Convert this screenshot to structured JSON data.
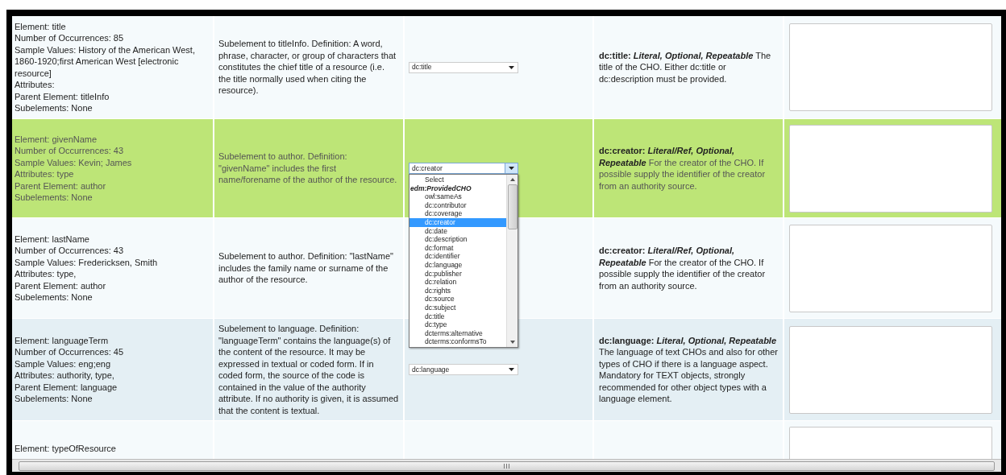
{
  "rows": [
    {
      "selected": false,
      "element_info": [
        "Element: title",
        "Number of Occurrences: 85",
        "Sample Values: History of the American West, 1860-1920;first American West [electronic resource]",
        "Attributes:",
        "Parent Element: titleInfo",
        "Subelements: None"
      ],
      "definition": "Subelement to titleInfo. Definition: A word, phrase, character, or group of characters that constitutes the chief title of a resource (i.e. the title normally used when citing the resource).",
      "mapping": {
        "value": "dc:title",
        "expanded": false
      },
      "note": {
        "term": "dc:title:",
        "qualifiers": "Literal, Optional, Repeatable",
        "text": "The title of the CHO. Either dc:title or dc:description must be provided."
      },
      "input": {
        "kind": "textarea"
      }
    },
    {
      "selected": true,
      "element_info": [
        "Element: givenName",
        "Number of Occurrences: 43",
        "Sample Values: Kevin; James",
        "Attributes: type",
        "Parent Element: author",
        "Subelements: None"
      ],
      "definition": "Subelement to author. Definition: \"givenName\" includes the first name/forename of the author of the resource.",
      "mapping": {
        "value": "dc:creator",
        "expanded": true,
        "options": [
          {
            "label": "Select",
            "kind": "option",
            "selected": false
          },
          {
            "label": "edm:ProvidedCHO",
            "kind": "group",
            "selected": false
          },
          {
            "label": "owl:sameAs",
            "kind": "option",
            "selected": false
          },
          {
            "label": "dc:contributor",
            "kind": "option",
            "selected": false
          },
          {
            "label": "dc:coverage",
            "kind": "option",
            "selected": false
          },
          {
            "label": "dc:creator",
            "kind": "option",
            "selected": true
          },
          {
            "label": "dc:date",
            "kind": "option",
            "selected": false
          },
          {
            "label": "dc:description",
            "kind": "option",
            "selected": false
          },
          {
            "label": "dc:format",
            "kind": "option",
            "selected": false
          },
          {
            "label": "dc:identifier",
            "kind": "option",
            "selected": false
          },
          {
            "label": "dc:language",
            "kind": "option",
            "selected": false
          },
          {
            "label": "dc:publisher",
            "kind": "option",
            "selected": false
          },
          {
            "label": "dc:relation",
            "kind": "option",
            "selected": false
          },
          {
            "label": "dc:rights",
            "kind": "option",
            "selected": false
          },
          {
            "label": "dc:source",
            "kind": "option",
            "selected": false
          },
          {
            "label": "dc:subject",
            "kind": "option",
            "selected": false
          },
          {
            "label": "dc:title",
            "kind": "option",
            "selected": false
          },
          {
            "label": "dc:type",
            "kind": "option",
            "selected": false
          },
          {
            "label": "dcterms:alternative",
            "kind": "option",
            "selected": false
          },
          {
            "label": "dcterms:conformsTo",
            "kind": "option",
            "selected": false
          }
        ]
      },
      "note": {
        "term": "dc:creator:",
        "qualifiers": "Literal/Ref, Optional, Repeatable",
        "text": "For the creator of the CHO. If possible supply the identifier of the creator from an authority source."
      },
      "input": {
        "kind": "textarea"
      }
    },
    {
      "selected": false,
      "element_info": [
        "Element: lastName",
        "Number of Occurrences: 43",
        "Sample Values: Fredericksen, Smith",
        "Attributes: type,",
        "Parent Element: author",
        "Subelements: None"
      ],
      "definition": "Subelement to author. Definition: \"lastName\" includes the family name or surname of the author of the resource.",
      "note": {
        "term": "dc:creator:",
        "qualifiers": "Literal/Ref, Optional, Repeatable",
        "text": "For the creator of the CHO. If possible supply the identifier of the creator from an authority source."
      },
      "input": {
        "kind": "textarea"
      }
    },
    {
      "selected": false,
      "element_info": [
        "Element: languageTerm",
        "Number of Occurrences: 45",
        "Sample Values: eng;eng",
        "Attributes: authority, type,",
        "Parent Element: language",
        "Subelements: None"
      ],
      "definition": "Subelement to language. Definition: \"languageTerm\" contains the language(s) of the content of the resource. It may be expressed in textual or coded form. If in coded form, the source of the code is contained in the value of the authority attribute. If no authority is given, it is assumed that the content is textual.",
      "mapping": {
        "value": "dc:language",
        "expanded": false
      },
      "note": {
        "term": "dc:language:",
        "qualifiers": "Literal, Optional, Repeatable",
        "text": "The language of text CHOs and also for other types of CHO if there is a language aspect. Mandatory for TEXT objects, strongly recommended for other object types with a language element."
      },
      "input": {
        "kind": "textarea"
      }
    },
    {
      "selected": false,
      "element_info": [
        "Element: typeOfResource"
      ],
      "input": {
        "kind": "textarea"
      }
    }
  ]
}
